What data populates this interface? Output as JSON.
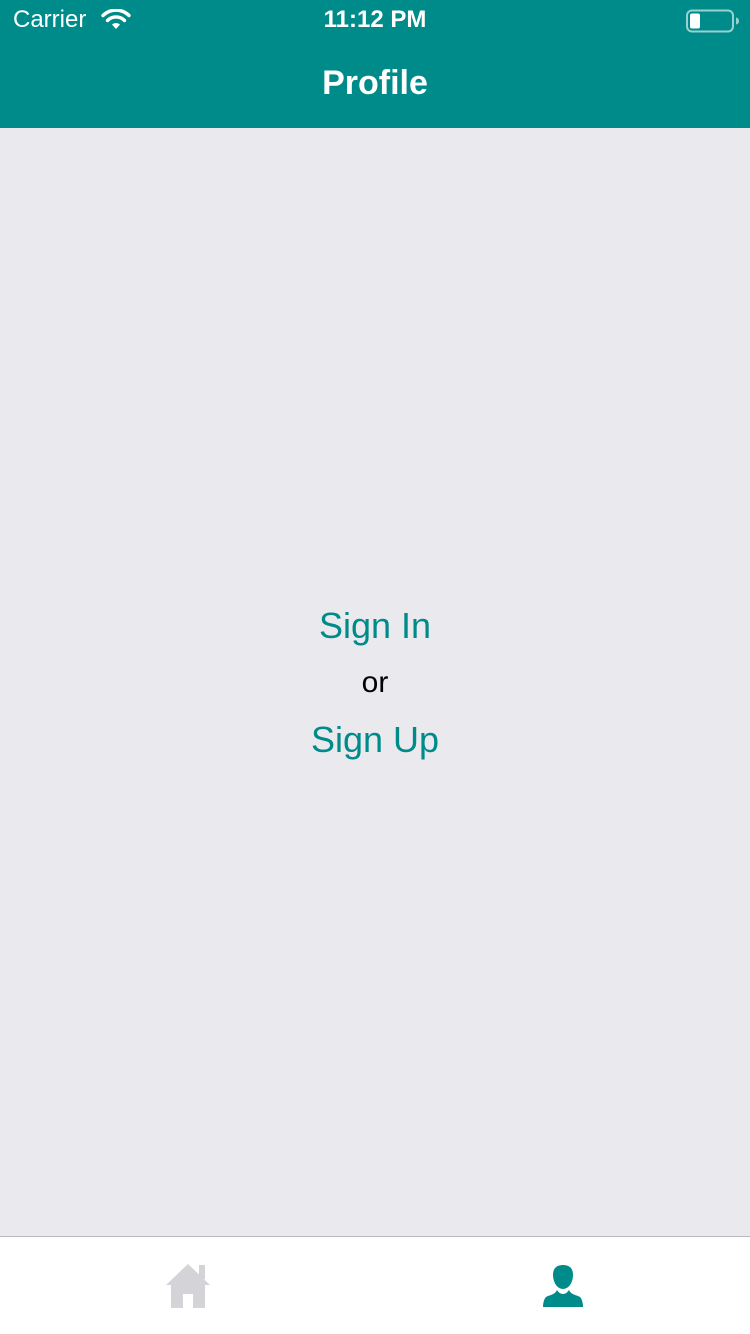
{
  "status_bar": {
    "carrier": "Carrier",
    "time": "11:12 PM",
    "wifi_icon": "wifi-icon",
    "battery_icon": "battery-icon"
  },
  "nav": {
    "title": "Profile"
  },
  "auth": {
    "sign_in_label": "Sign In",
    "or_label": "or",
    "sign_up_label": "Sign Up"
  },
  "tab_bar": {
    "tabs": [
      {
        "icon": "home-icon",
        "selected": false
      },
      {
        "icon": "person-icon",
        "selected": true
      }
    ]
  },
  "colors": {
    "accent": "#008b8b",
    "background": "#e9e9ee",
    "tab_inactive": "#d3d3d8",
    "text": "#000000",
    "header_text": "#ffffff"
  }
}
